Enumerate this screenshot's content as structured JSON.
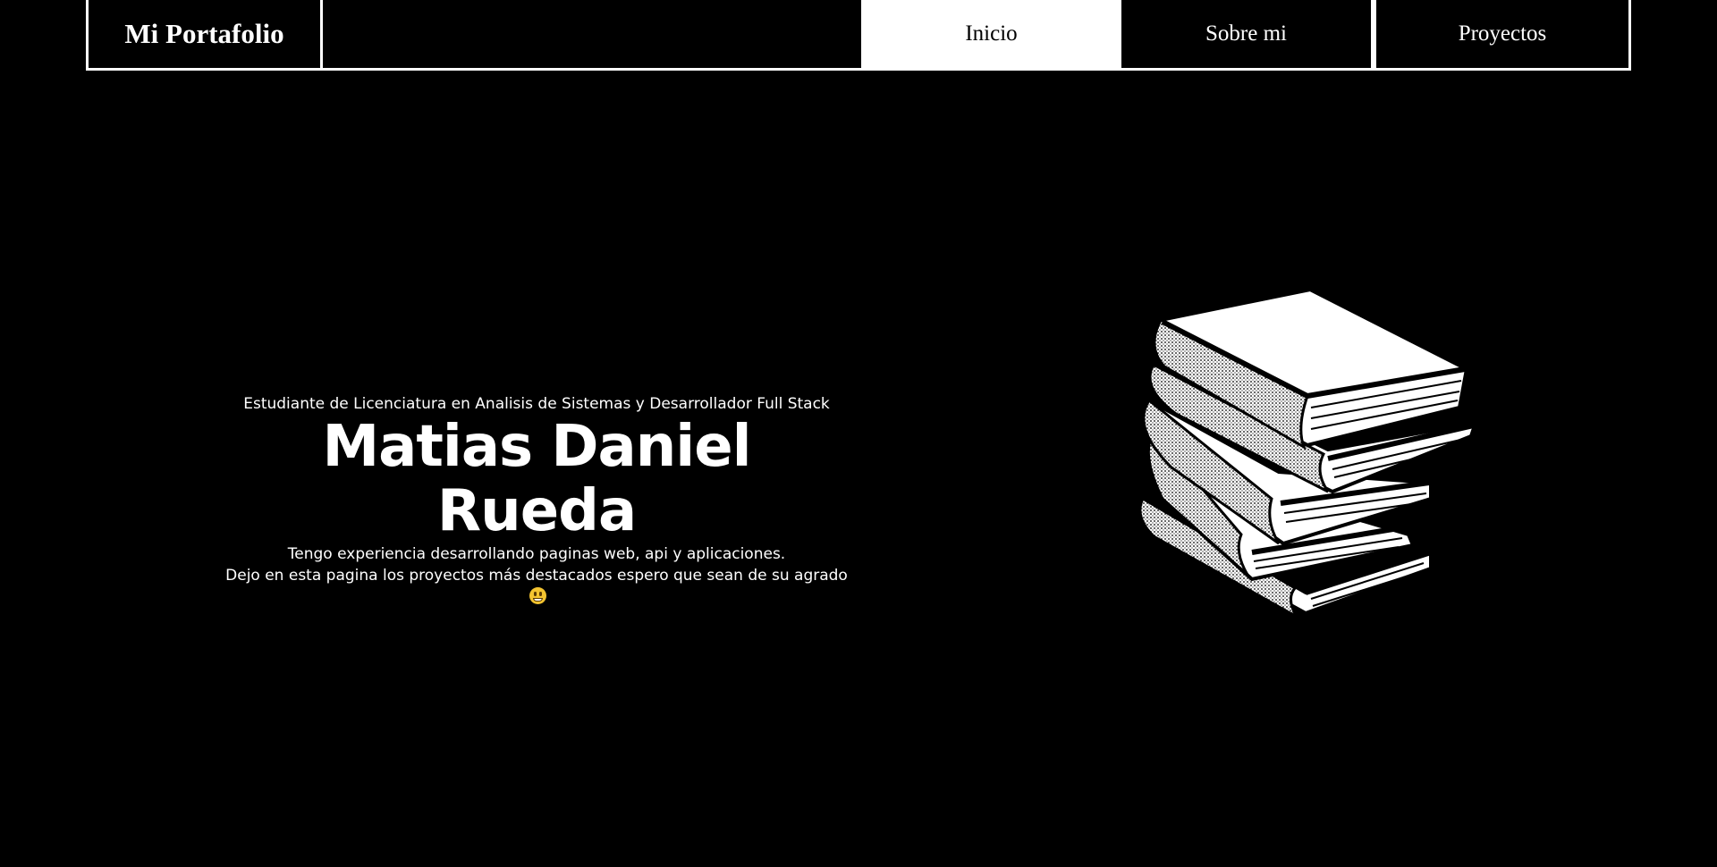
{
  "nav": {
    "brand": "Mi Portafolio",
    "items": [
      {
        "label": "Inicio"
      },
      {
        "label": "Sobre mi"
      },
      {
        "label": "Proyectos"
      }
    ]
  },
  "hero": {
    "subtitle": "Estudiante de Licenciatura en Analisis de Sistemas y Desarrollador Full Stack",
    "name": "Matias Daniel Rueda",
    "desc_line1": "Tengo experiencia desarrollando paginas web, api y aplicaciones.",
    "desc_line2": "Dejo en esta pagina los proyectos más destacados espero que sean de su agrado"
  },
  "colors": {
    "background": "#000000",
    "foreground": "#ffffff",
    "active_nav_bg": "#ffffff",
    "active_nav_text": "#000000"
  },
  "icons": {
    "hero_illustration": "stack-of-books",
    "emoji": "grinning-face-emoji"
  }
}
